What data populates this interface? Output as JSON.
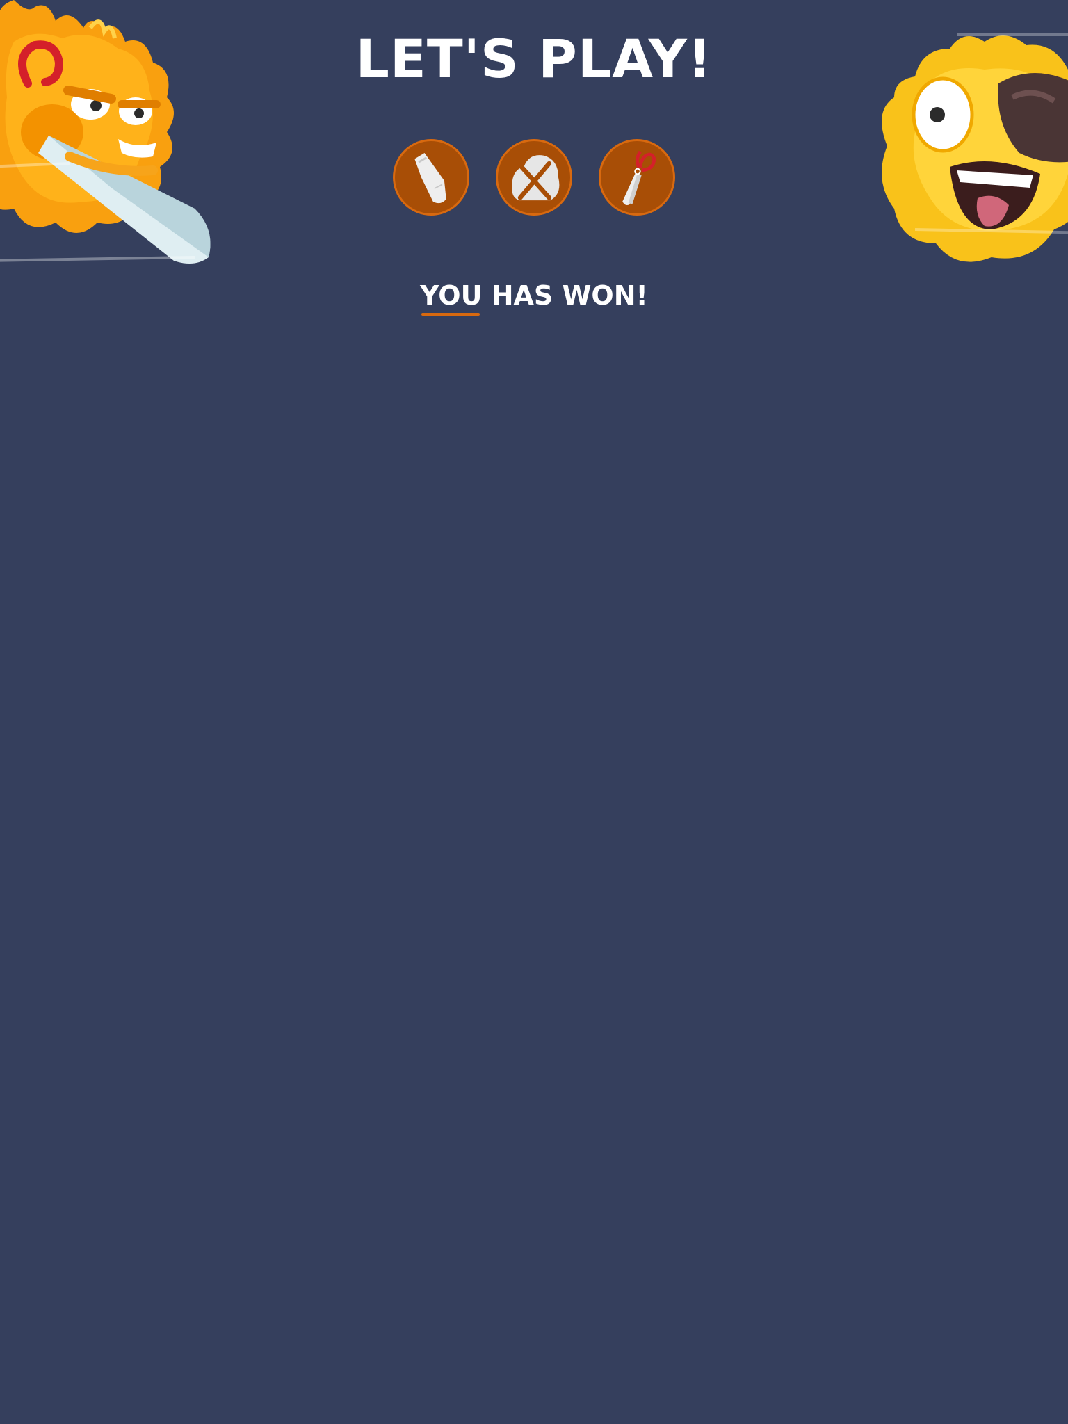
{
  "header": {
    "title": "LET'S PLAY!"
  },
  "choices": [
    {
      "name": "paper",
      "icon": "paper-icon"
    },
    {
      "name": "rock",
      "icon": "rock-icon"
    },
    {
      "name": "scissors",
      "icon": "scissors-icon"
    }
  ],
  "result": {
    "text": "YOU HAS WON!"
  },
  "colors": {
    "background": "#353f5d",
    "accent": "#d8690f",
    "button_fill": "#a84e06"
  }
}
